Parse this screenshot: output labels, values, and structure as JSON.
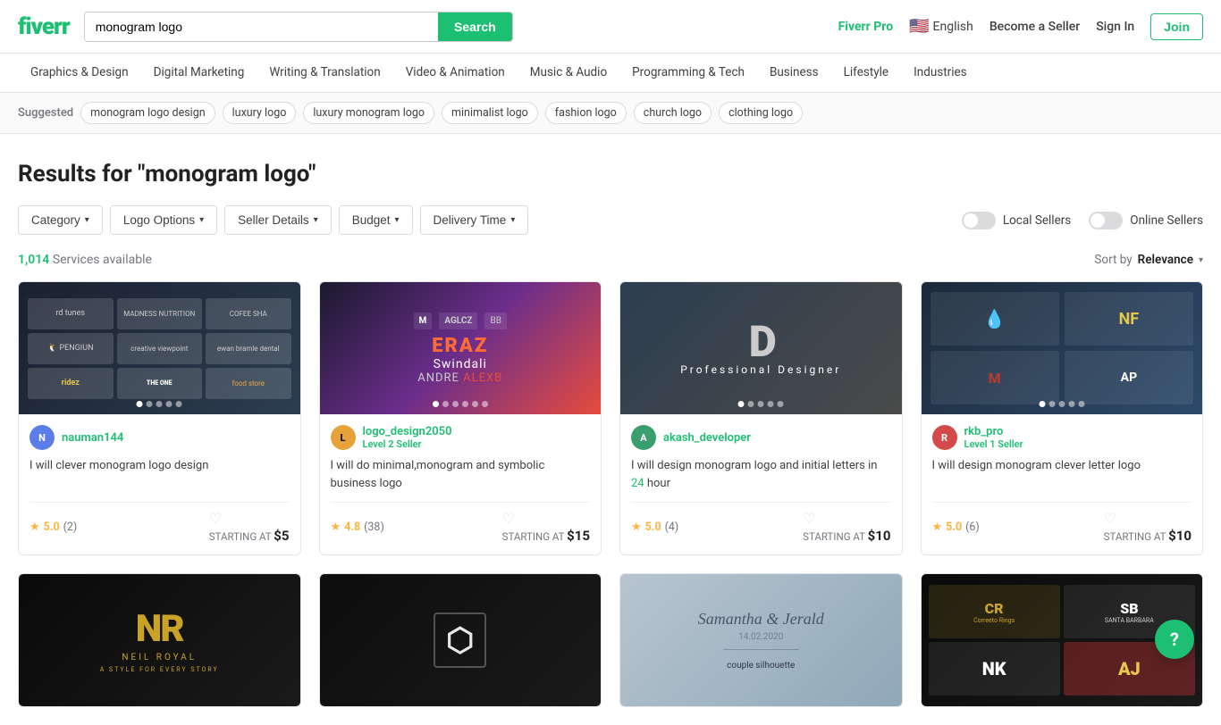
{
  "header": {
    "logo": "fiverr",
    "search_placeholder": "monogram logo",
    "search_value": "monogram logo",
    "search_button": "Search",
    "fiverr_pro": "Fiverr Pro",
    "language": "English",
    "become_seller": "Become a Seller",
    "sign_in": "Sign In",
    "join": "Join"
  },
  "nav": {
    "items": [
      {
        "label": "Graphics & Design"
      },
      {
        "label": "Digital Marketing"
      },
      {
        "label": "Writing & Translation"
      },
      {
        "label": "Video & Animation"
      },
      {
        "label": "Music & Audio"
      },
      {
        "label": "Programming & Tech"
      },
      {
        "label": "Business"
      },
      {
        "label": "Lifestyle"
      },
      {
        "label": "Industries"
      }
    ]
  },
  "suggested": {
    "label": "Suggested",
    "tags": [
      "monogram logo design",
      "luxury logo",
      "luxury monogram logo",
      "minimalist logo",
      "fashion logo",
      "church logo",
      "clothing logo"
    ]
  },
  "results": {
    "title": "Results for \"monogram logo\"",
    "count": "1,014",
    "services_text": "Services available",
    "sort_label": "Sort by",
    "sort_value": "Relevance"
  },
  "filters": {
    "category": "Category",
    "logo_options": "Logo Options",
    "seller_details": "Seller Details",
    "budget": "Budget",
    "delivery_time": "Delivery Time",
    "local_sellers": "Local Sellers",
    "online_sellers": "Online Sellers"
  },
  "cards": [
    {
      "seller": "nauman144",
      "badge": "",
      "avatar_bg": "#5a7de8",
      "avatar_letter": "N",
      "title": "I will clever monogram logo design",
      "rating": "5.0",
      "review_count": "2",
      "starting_at": "STARTING AT",
      "price": "$5",
      "img_type": "img-dark-portfolio",
      "img_label": "Portfolio Grid"
    },
    {
      "seller": "logo_design2050",
      "badge": "Level 2 Seller",
      "badge_color": "green",
      "avatar_bg": "#e8a23a",
      "avatar_letter": "L",
      "title": "I will do minimal,monogram and symbolic business logo",
      "rating": "4.8",
      "review_count": "38",
      "starting_at": "STARTING AT",
      "price": "$15",
      "img_type": "img-galaxy",
      "img_label": "Galaxy Monogram"
    },
    {
      "seller": "akash_developer",
      "badge": "",
      "avatar_bg": "#3a9e6e",
      "avatar_letter": "A",
      "title": "I will design monogram logo and initial letters in 24 hour",
      "rating": "5.0",
      "review_count": "4",
      "starting_at": "STARTING AT",
      "price": "$10",
      "img_type": "img-gray-designer",
      "img_label": "Professional Designer"
    },
    {
      "seller": "rkb_pro",
      "badge": "Level 1 Seller",
      "badge_color": "green",
      "avatar_bg": "#d44a4a",
      "avatar_letter": "R",
      "title": "I will design monogram clever letter logo",
      "rating": "5.0",
      "review_count": "6",
      "starting_at": "STARTING AT",
      "price": "$10",
      "img_type": "img-dark-mono",
      "img_label": "Monogram Collage"
    },
    {
      "seller": "",
      "badge": "",
      "avatar_bg": "#1dbf73",
      "avatar_letter": "",
      "title": "",
      "rating": "",
      "review_count": "",
      "starting_at": "",
      "price": "",
      "img_type": "img-gold-nroval",
      "img_label": "NR Royal"
    },
    {
      "seller": "",
      "badge": "",
      "avatar_bg": "#333",
      "avatar_letter": "",
      "title": "",
      "rating": "",
      "review_count": "",
      "starting_at": "",
      "price": "",
      "img_type": "img-dark-ornate",
      "img_label": "Ornate Monogram"
    },
    {
      "seller": "",
      "badge": "",
      "avatar_bg": "#888",
      "avatar_letter": "",
      "title": "",
      "rating": "",
      "review_count": "",
      "starting_at": "",
      "price": "",
      "img_type": "img-wedding-script",
      "img_label": "Wedding Script"
    },
    {
      "seller": "",
      "badge": "",
      "avatar_bg": "#222",
      "avatar_letter": "",
      "title": "",
      "rating": "",
      "review_count": "",
      "starting_at": "",
      "price": "",
      "img_type": "img-rings",
      "img_label": "Rings & Luxury"
    }
  ],
  "icons": {
    "search": "🔍",
    "chevron_down": "▾",
    "heart": "♡",
    "star": "★",
    "question": "?",
    "flag_us": "🇺🇸"
  }
}
